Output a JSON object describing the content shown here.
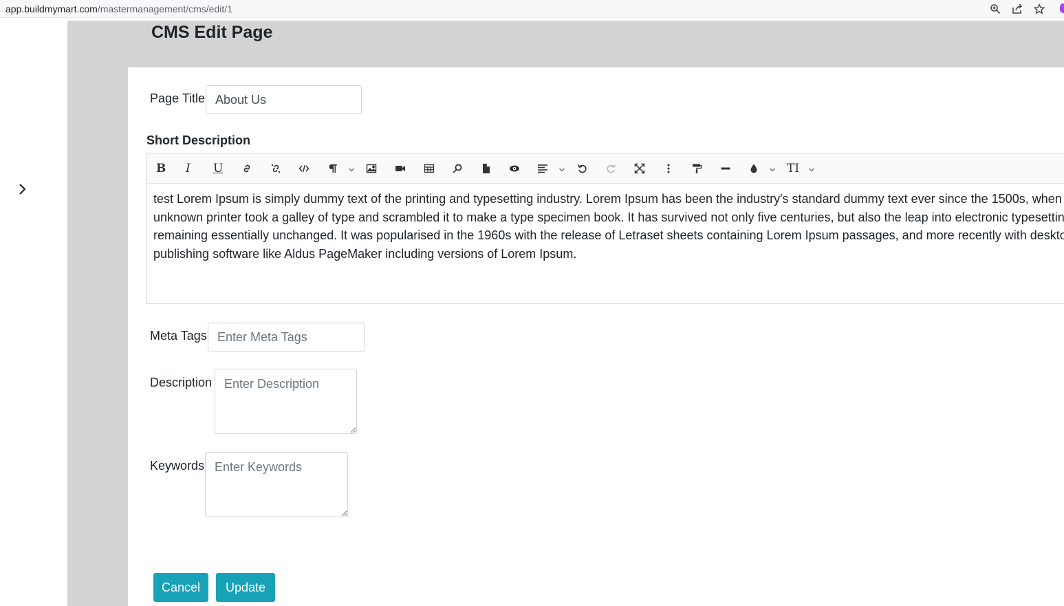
{
  "browser": {
    "url_host": "app.buildmymart.com",
    "url_path": "/mastermanagement/cms/edit/1"
  },
  "page": {
    "title": "CMS Edit Page"
  },
  "form": {
    "page_title_label": "Page Title",
    "page_title_value": "About Us",
    "short_description_label": "Short Description",
    "short_description_content": "test Lorem Ipsum is simply dummy text of the printing and typesetting industry. Lorem Ipsum has been the industry's standard dummy text ever since the 1500s, when an unknown printer took a galley of type and scrambled it to make a type specimen book. It has survived not only five centuries, but also the leap into electronic typesetting, remaining essentially unchanged. It was popularised in the 1960s with the release of Letraset sheets containing Lorem Ipsum passages, and more recently with desktop publishing software like Aldus PageMaker including versions of Lorem Ipsum.",
    "meta_tags_label": "Meta Tags",
    "meta_tags_placeholder": "Enter Meta Tags",
    "description_label": "Description",
    "description_placeholder": "Enter Description",
    "keywords_label": "Keywords",
    "keywords_placeholder": "Enter Keywords"
  },
  "toolbar": {
    "bold": "B",
    "italic": "I",
    "underline": "U",
    "font_size": "TI"
  },
  "actions": {
    "cancel_label": "Cancel",
    "update_label": "Update"
  },
  "colors": {
    "accent": "#17a2b8",
    "main_bg": "#d3d3d3"
  }
}
